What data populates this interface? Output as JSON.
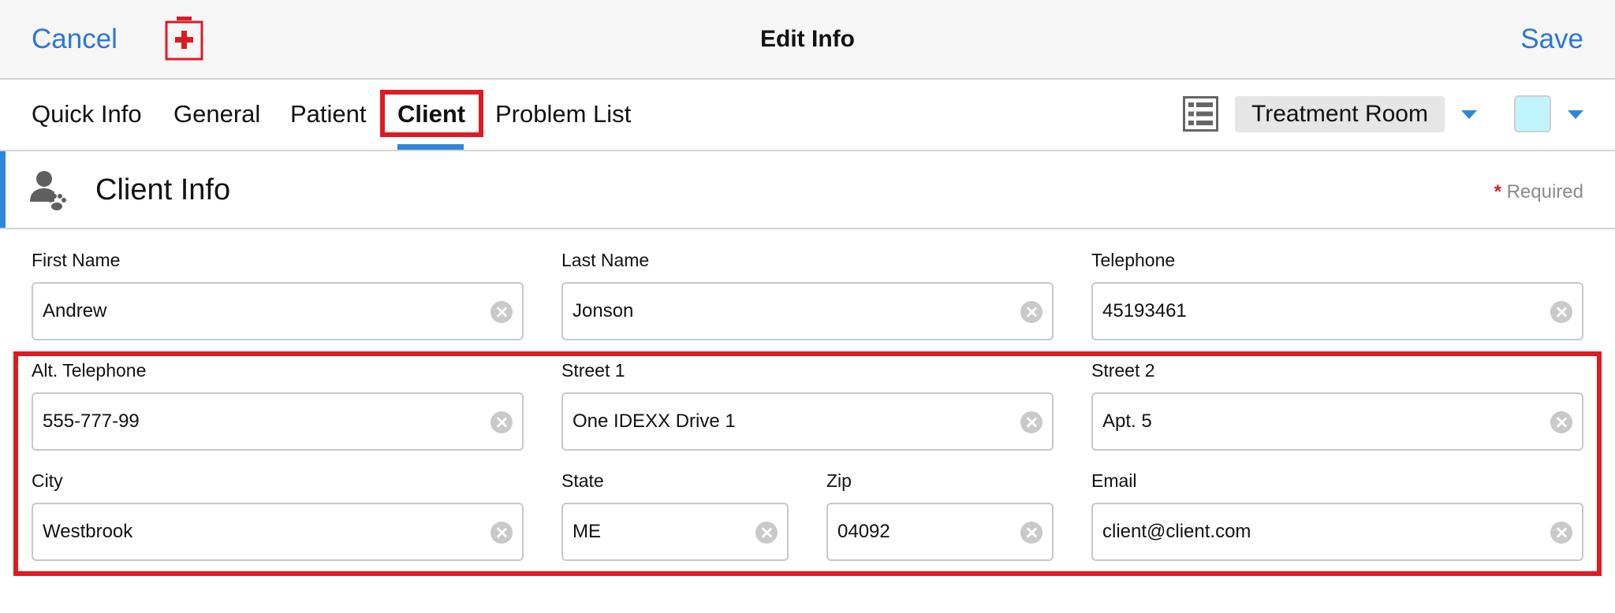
{
  "navbar": {
    "cancel_label": "Cancel",
    "title": "Edit Info",
    "save_label": "Save",
    "icon": "medical-kit-icon"
  },
  "tabs": [
    {
      "label": "Quick Info",
      "active": false
    },
    {
      "label": "General",
      "active": false
    },
    {
      "label": "Patient",
      "active": false
    },
    {
      "label": "Client",
      "active": true
    },
    {
      "label": "Problem List",
      "active": false
    }
  ],
  "toolbar": {
    "list_icon": "list-icon",
    "room": "Treatment Room",
    "color_swatch": "#bff4fc"
  },
  "section": {
    "title": "Client Info",
    "icon": "client-paw-icon",
    "required_star": "*",
    "required_label": "Required"
  },
  "fields": {
    "first_name": {
      "label": "First Name",
      "value": "Andrew"
    },
    "last_name": {
      "label": "Last Name",
      "value": "Jonson"
    },
    "telephone": {
      "label": "Telephone",
      "value": "45193461"
    },
    "alt_telephone": {
      "label": "Alt. Telephone",
      "value": "555-777-99"
    },
    "street1": {
      "label": "Street 1",
      "value": "One IDEXX Drive 1"
    },
    "street2": {
      "label": "Street 2",
      "value": "Apt. 5"
    },
    "city": {
      "label": "City",
      "value": "Westbrook"
    },
    "state": {
      "label": "State",
      "value": "ME"
    },
    "zip": {
      "label": "Zip",
      "value": "04092"
    },
    "email": {
      "label": "Email",
      "value": "client@client.com"
    }
  },
  "colors": {
    "accent": "#2f86d8",
    "link": "#2a77d6",
    "highlight": "#e01a22",
    "brand_red": "#d91c24"
  }
}
